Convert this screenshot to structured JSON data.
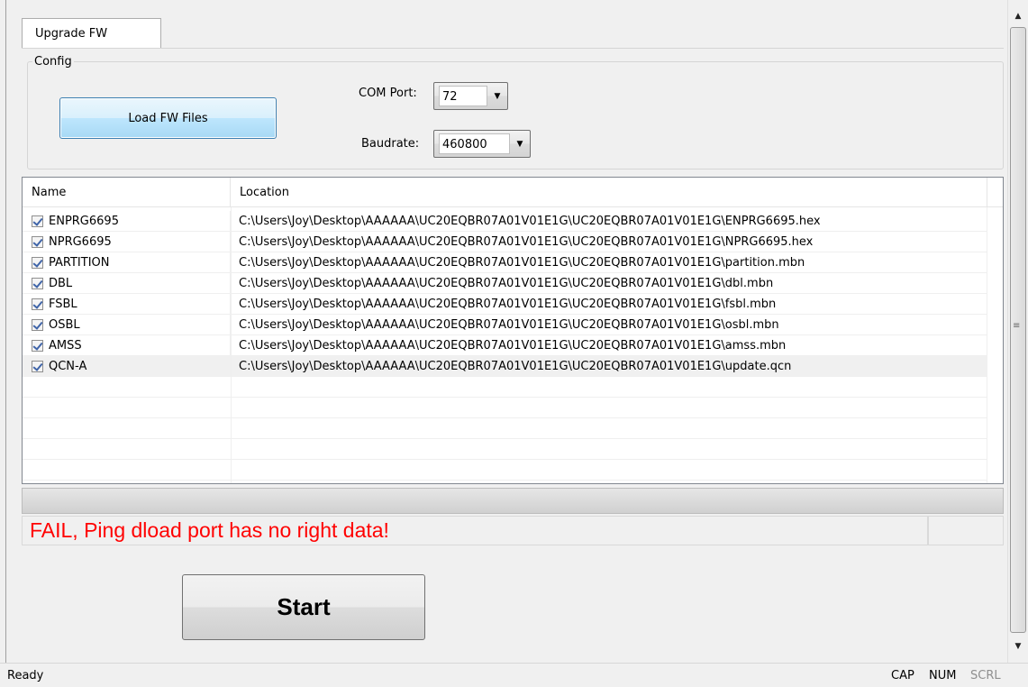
{
  "tab": {
    "label": "Upgrade FW"
  },
  "config": {
    "group_label": "Config",
    "load_button": "Load FW Files",
    "com_port_label": "COM Port:",
    "com_port_value": "72",
    "baudrate_label": "Baudrate:",
    "baudrate_value": "460800"
  },
  "list": {
    "columns": [
      "Name",
      "Location"
    ],
    "rows": [
      {
        "name": "ENPRG6695",
        "checked": true,
        "location": "C:\\Users\\Joy\\Desktop\\AAAAAA\\UC20EQBR07A01V01E1G\\UC20EQBR07A01V01E1G\\ENPRG6695.hex"
      },
      {
        "name": "NPRG6695",
        "checked": true,
        "location": "C:\\Users\\Joy\\Desktop\\AAAAAA\\UC20EQBR07A01V01E1G\\UC20EQBR07A01V01E1G\\NPRG6695.hex"
      },
      {
        "name": "PARTITION",
        "checked": true,
        "location": "C:\\Users\\Joy\\Desktop\\AAAAAA\\UC20EQBR07A01V01E1G\\UC20EQBR07A01V01E1G\\partition.mbn"
      },
      {
        "name": "DBL",
        "checked": true,
        "location": "C:\\Users\\Joy\\Desktop\\AAAAAA\\UC20EQBR07A01V01E1G\\UC20EQBR07A01V01E1G\\dbl.mbn"
      },
      {
        "name": "FSBL",
        "checked": true,
        "location": "C:\\Users\\Joy\\Desktop\\AAAAAA\\UC20EQBR07A01V01E1G\\UC20EQBR07A01V01E1G\\fsbl.mbn"
      },
      {
        "name": "OSBL",
        "checked": true,
        "location": "C:\\Users\\Joy\\Desktop\\AAAAAA\\UC20EQBR07A01V01E1G\\UC20EQBR07A01V01E1G\\osbl.mbn"
      },
      {
        "name": "AMSS",
        "checked": true,
        "location": "C:\\Users\\Joy\\Desktop\\AAAAAA\\UC20EQBR07A01V01E1G\\UC20EQBR07A01V01E1G\\amss.mbn"
      },
      {
        "name": "QCN-A",
        "checked": true,
        "location": "C:\\Users\\Joy\\Desktop\\AAAAAA\\UC20EQBR07A01V01E1G\\UC20EQBR07A01V01E1G\\update.qcn"
      }
    ]
  },
  "progress": {
    "value": 0
  },
  "status_message": "FAIL, Ping dload port has no right data!",
  "start_button": "Start",
  "statusbar": {
    "ready": "Ready",
    "cap": "CAP",
    "num": "NUM",
    "scrl": "SCRL"
  },
  "colors": {
    "error_text": "#ff0000"
  },
  "icons": {
    "scroll_up": "triangle-up-icon",
    "scroll_down": "triangle-down-icon",
    "dropdown": "triangle-down-icon",
    "check": "checkmark-icon"
  }
}
